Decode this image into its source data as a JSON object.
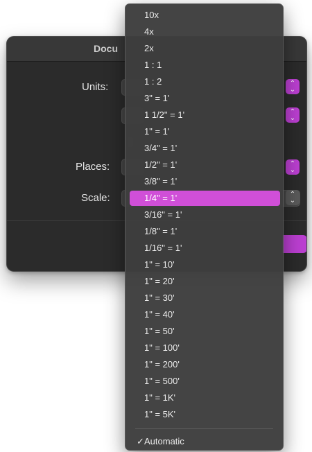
{
  "dialog": {
    "title": "Docu",
    "labels": {
      "units": "Units:",
      "places": "Places:",
      "scale": "Scale:"
    }
  },
  "scale_menu": {
    "items": [
      {
        "label": "10x"
      },
      {
        "label": "4x"
      },
      {
        "label": "2x"
      },
      {
        "label": "1 : 1"
      },
      {
        "label": "1 : 2"
      },
      {
        "label": "3\" = 1'"
      },
      {
        "label": "1 1/2\" = 1'"
      },
      {
        "label": "1\" = 1'"
      },
      {
        "label": "3/4\" = 1'"
      },
      {
        "label": "1/2\" = 1'"
      },
      {
        "label": "3/8\" = 1'"
      },
      {
        "label": "1/4\" = 1'",
        "selected": true
      },
      {
        "label": "3/16\" = 1'"
      },
      {
        "label": "1/8\" = 1'"
      },
      {
        "label": "1/16\" = 1'"
      },
      {
        "label": "1\" = 10'"
      },
      {
        "label": "1\" = 20'"
      },
      {
        "label": "1\" = 30'"
      },
      {
        "label": "1\" = 40'"
      },
      {
        "label": "1\" = 50'"
      },
      {
        "label": "1\" = 100'"
      },
      {
        "label": "1\" = 200'"
      },
      {
        "label": "1\" = 500'"
      },
      {
        "label": "1\" = 1K'"
      },
      {
        "label": "1\" = 5K'"
      }
    ],
    "automatic": {
      "label": "Automatic",
      "checked": true,
      "check_glyph": "✓"
    }
  },
  "colors": {
    "accent": "#bb3fd1",
    "highlight": "#d04fd8"
  }
}
